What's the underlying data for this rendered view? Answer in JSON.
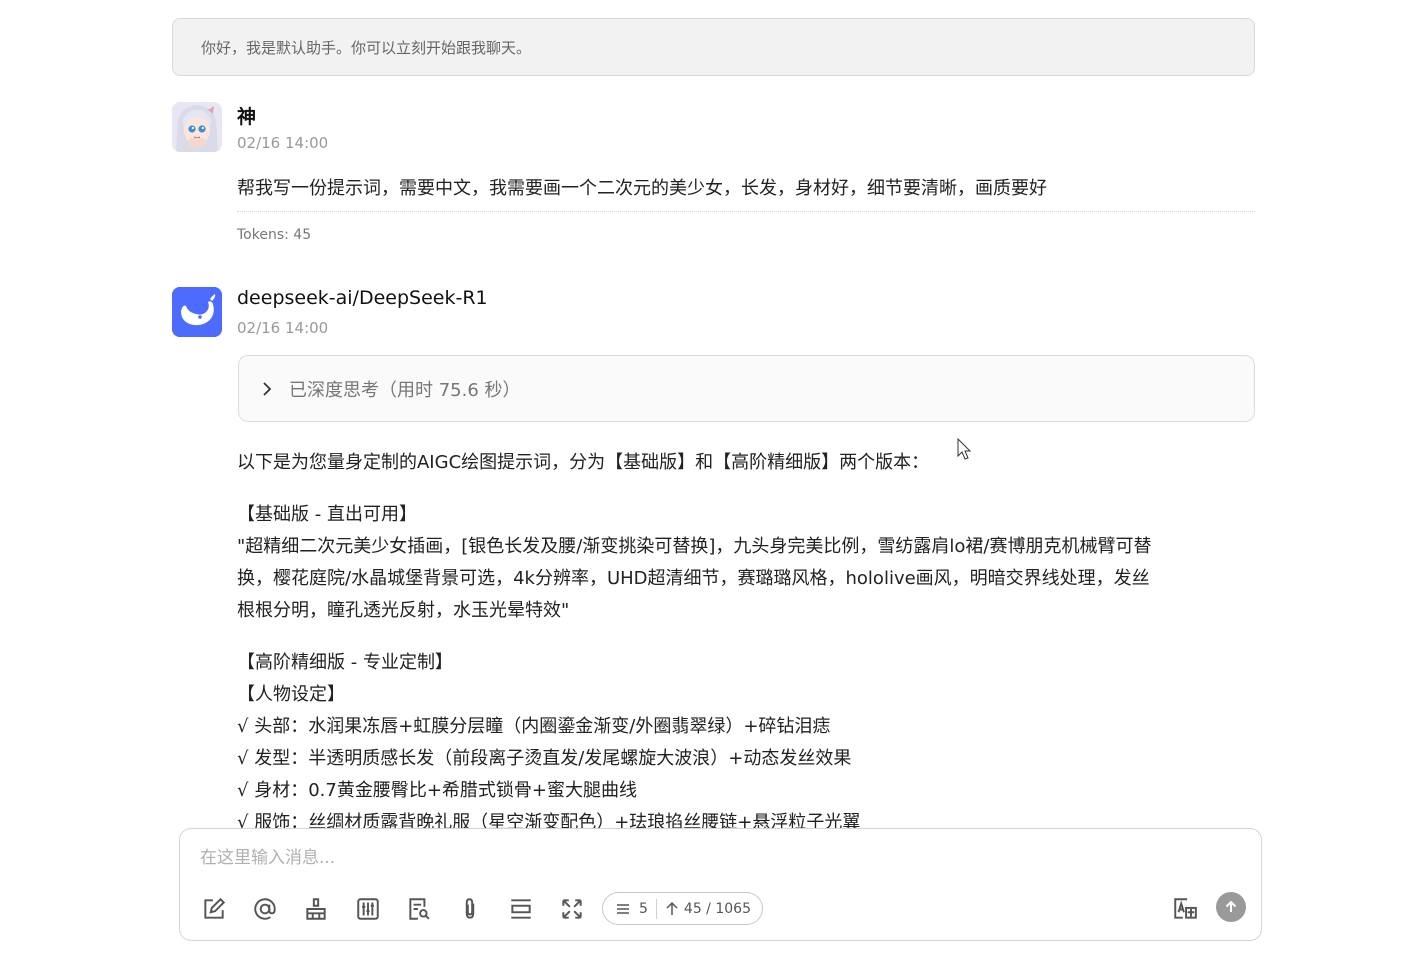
{
  "system_message": "你好，我是默认助手。你可以立刻开始跟我聊天。",
  "user_message": {
    "name": "神",
    "time": "02/16 14:00",
    "text": "帮我写一份提示词，需要中文，我需要画一个二次元的美少女，长发，身材好，细节要清晰，画质要好",
    "tokens": "Tokens: 45"
  },
  "assistant_message": {
    "name": "deepseek-ai/DeepSeek-R1",
    "time": "02/16 14:00",
    "thinking_label": "已深度思考（用时 75.6 秒）",
    "intro": "以下是为您量身定制的AIGC绘图提示词，分为【基础版】和【高阶精细版】两个版本：",
    "basic_title": "【基础版 - 直出可用】",
    "basic_lines": [
      "\"超精细二次元美少女插画，[银色长发及腰/渐变挑染可替换]，九头身完美比例，雪纺露肩lo裙/赛博朋克机械臂可替",
      "换，樱花庭院/水晶城堡背景可选，4k分辨率，UHD超清细节，赛璐璐风格，hololive画风，明暗交界线处理，发丝",
      "根根分明，瞳孔透光反射，水玉光晕特效\""
    ],
    "advanced_title": "【高阶精细版 - 专业定制】",
    "character_title": "【人物设定】",
    "character_lines": [
      "√ 头部：水润果冻唇+虹膜分层瞳（内圈鎏金渐变/外圈翡翠绿）+碎钻泪痣",
      "√ 发型：半透明质感长发（前段离子烫直发/发尾螺旋大波浪）+动态发丝效果",
      "√ 身材：0.7黄金腰臀比+希腊式锁骨+蜜大腿曲线",
      "√ 服饰：丝绸材质露背晚礼服（星空渐变配色）+珐琅掐丝腰链+悬浮粒子光翼"
    ]
  },
  "composer": {
    "placeholder": "在这里输入消息...",
    "value": "",
    "message_count": "5",
    "token_count": "45 / 1065"
  },
  "colors": {
    "deepseek_brand": "#4D6BFE",
    "send_button": "#9A9A9A"
  }
}
